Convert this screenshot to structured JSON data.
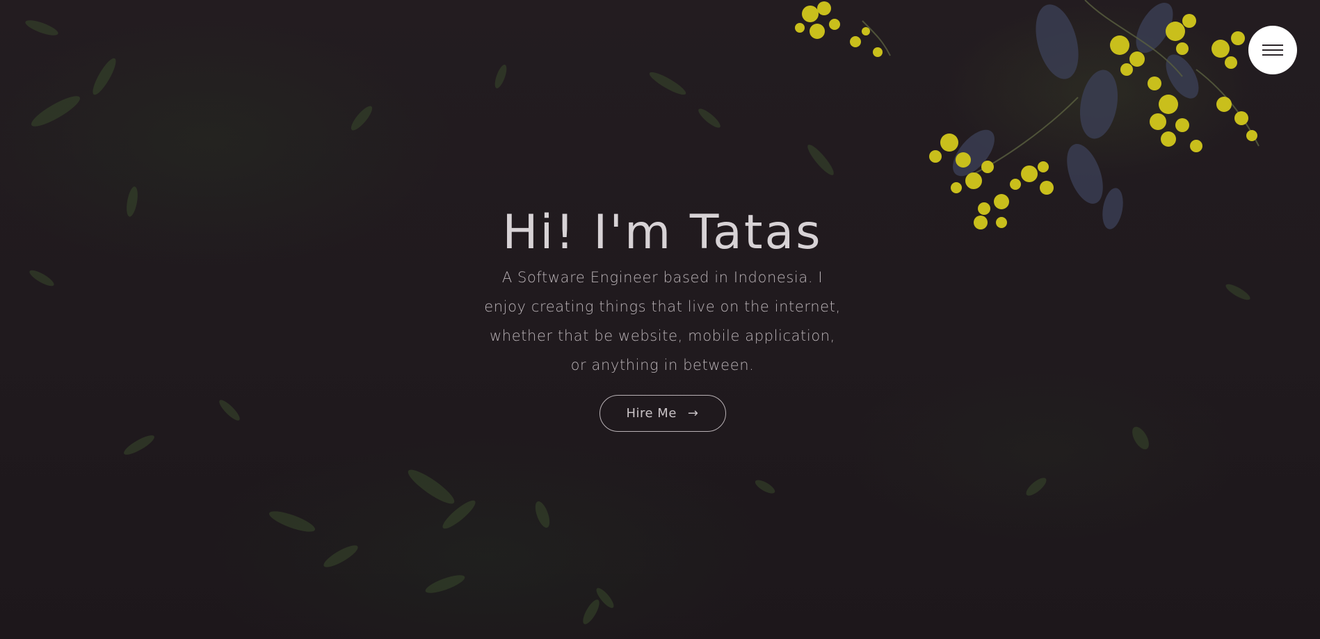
{
  "hero": {
    "title": "Hi! I'm Tatas",
    "subtitle": "A Software Engineer based in Indonesia. I enjoy creating things that live on the internet, whether that be website, mobile application, or anything in between.",
    "cta_label": "Hire Me",
    "cta_icon": "→"
  },
  "menu": {
    "icon": "hamburger-menu-icon"
  },
  "colors": {
    "background": "#1f1a1e",
    "title": "#d7d2d5",
    "text": "#b9b2b6",
    "flowers": "#d6cb1e",
    "menu_button": "#ffffff"
  }
}
